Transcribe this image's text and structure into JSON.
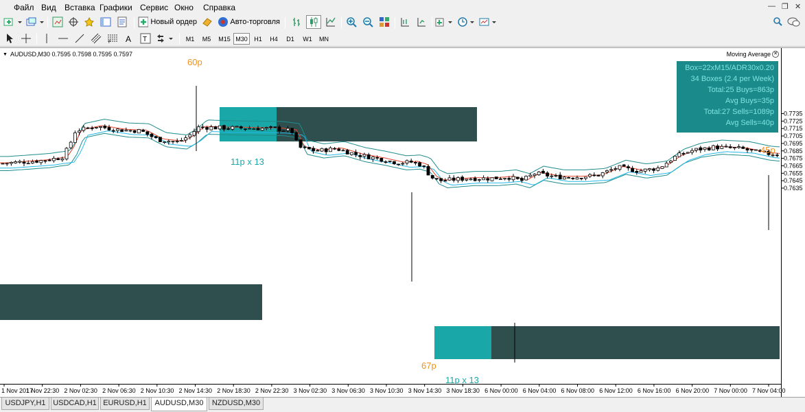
{
  "menu": [
    "Файл",
    "Вид",
    "Вставка",
    "Графики",
    "Сервис",
    "Окно",
    "Справка"
  ],
  "toolbar": {
    "new_order": "Новый ордер",
    "auto_trading": "Авто-торговля"
  },
  "timeframes": [
    "M1",
    "M5",
    "M15",
    "M30",
    "H1",
    "H4",
    "D1",
    "W1",
    "MN"
  ],
  "active_timeframe": "M30",
  "chart": {
    "symbol_info": "AUDUSD,M30  0.7595 0.7598 0.7595 0.7597",
    "indicator": "Moving Average",
    "info_box": [
      "Box=22xM15/ADR30x0.20",
      "34 Boxes (2.4 per Week)",
      "Total:25 Buys=863p",
      "Avg Buys=35p",
      "Total:27 Sells=1089p",
      "Avg Sells=40p"
    ],
    "annotations": {
      "a60": "60p",
      "a45": "45p",
      "a67": "67p",
      "box1": "11p x 13",
      "box2": "11p x 13"
    },
    "colors": {
      "teal_box": "#1aa7a7",
      "dark_box": "#2f4f4f",
      "annotation_orange": "#f0921e",
      "annotation_teal": "#1aa7a7",
      "info_bg": "#1a8a8a",
      "info_text": "#7fe3e3"
    }
  },
  "chart_data": {
    "type": "candlestick",
    "y_ticks": [
      "0.7735",
      "0.7725",
      "0.7715",
      "0.7705",
      "0.7695",
      "0.7685",
      "0.7675",
      "0.7665",
      "0.7655",
      "0.7645",
      "0.7635"
    ],
    "x_ticks": [
      "1 Nov 2017",
      "1 Nov 22:30",
      "2 Nov 02:30",
      "2 Nov 06:30",
      "2 Nov 10:30",
      "2 Nov 14:30",
      "2 Nov 18:30",
      "2 Nov 22:30",
      "3 Nov 02:30",
      "3 Nov 06:30",
      "3 Nov 10:30",
      "3 Nov 14:30",
      "3 Nov 18:30",
      "6 Nov 00:00",
      "6 Nov 04:00",
      "6 Nov 08:00",
      "6 Nov 12:00",
      "6 Nov 16:00",
      "6 Nov 20:00",
      "7 Nov 00:00",
      "7 Nov 04:00"
    ]
  },
  "tabs": [
    "USDJPY,H1",
    "USDCAD,H1",
    "EURUSD,H1",
    "AUDUSD,M30",
    "NZDUSD,M30"
  ],
  "active_tab": "AUDUSD,M30"
}
